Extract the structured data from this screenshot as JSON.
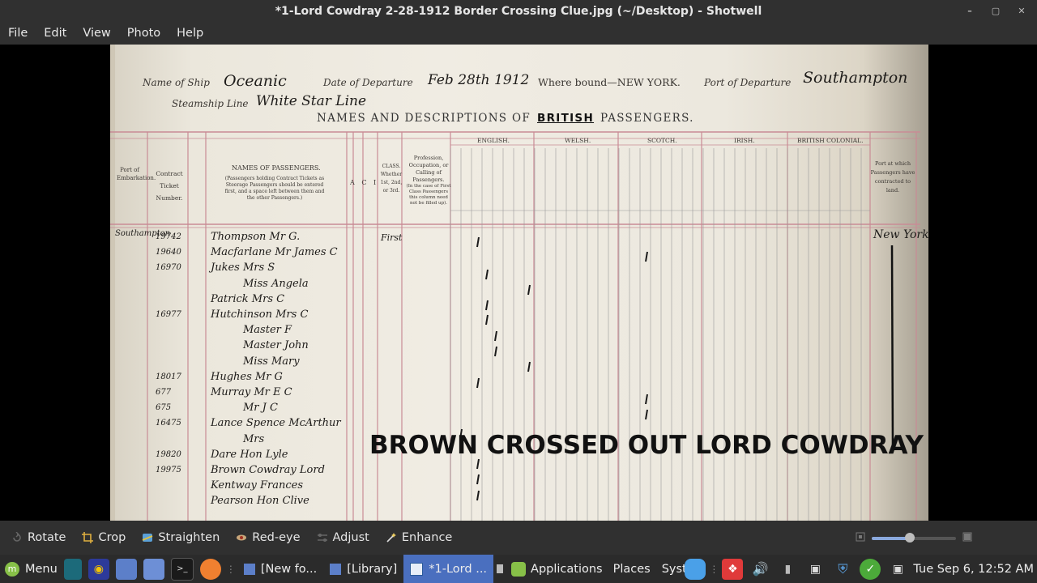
{
  "window": {
    "title": "*1-Lord Cowdray 2-28-1912 Border Crossing Clue.jpg (~/Desktop) - Shotwell",
    "minimize": "–",
    "restore": "▢",
    "close": "✕"
  },
  "menu": [
    "File",
    "Edit",
    "View",
    "Photo",
    "Help"
  ],
  "photo": {
    "header": {
      "name_of_ship_label": "Name of Ship",
      "name_of_ship": "Oceanic",
      "date_label": "Date of Departure",
      "date": "Feb 28th 1912",
      "where_bound_label": "Where bound—NEW YORK.",
      "port_label": "Port of Departure",
      "port": "Southampton",
      "steamship_label": "Steamship Line",
      "steamship": "White Star Line",
      "title_1": "NAMES AND DESCRIPTIONS OF",
      "title_british": "BRITISH",
      "title_2": "PASSENGERS."
    },
    "columns": {
      "port_embarkation": "Port of Embarkation.",
      "contract": "Contract Ticket Number.",
      "names": "NAMES OF PASSENGERS.",
      "names_note": "(Passengers holding Contract Tickets as Steerage Passengers should be entered first, and a space left between them and the other Passengers.)",
      "class_marks": "A C I",
      "class": "CLASS. Whether 1st, 2nd, or 3rd.",
      "profession": "Profession, Occupation, or Calling of Passengers.",
      "profession_note": "(In the case of First Class Passengers this column need not be filled up).",
      "groups": [
        "ENGLISH.",
        "WELSH.",
        "SCOTCH.",
        "IRISH.",
        "BRITISH COLONIAL."
      ],
      "port_landing": "Port at which Passengers have contracted to land."
    },
    "rows": [
      {
        "port": "Southampton",
        "ticket": "19742",
        "name": "Thompson Mr G.",
        "class": "First"
      },
      {
        "port": "",
        "ticket": "19640",
        "name": "Macfarlane Mr James C",
        "class": ""
      },
      {
        "port": "",
        "ticket": "16970",
        "name": "Jukes Mrs S",
        "class": ""
      },
      {
        "port": "",
        "ticket": "",
        "name": "Miss Angela",
        "class": ""
      },
      {
        "port": "",
        "ticket": "",
        "name": "Patrick Mrs C",
        "class": ""
      },
      {
        "port": "",
        "ticket": "16977",
        "name": "Hutchinson Mrs C",
        "class": ""
      },
      {
        "port": "",
        "ticket": "",
        "name": "Master F",
        "class": ""
      },
      {
        "port": "",
        "ticket": "",
        "name": "Master John",
        "class": ""
      },
      {
        "port": "",
        "ticket": "",
        "name": "Miss Mary",
        "class": ""
      },
      {
        "port": "",
        "ticket": "18017",
        "name": "Hughes Mr G",
        "class": ""
      },
      {
        "port": "",
        "ticket": "677",
        "name": "Murray Mr E C",
        "class": ""
      },
      {
        "port": "",
        "ticket": "675",
        "name": "Mr J C",
        "class": ""
      },
      {
        "port": "",
        "ticket": "16475",
        "name": "Lance Spence McArthur",
        "class": ""
      },
      {
        "port": "",
        "ticket": "",
        "name": "Mrs",
        "class": ""
      },
      {
        "port": "",
        "ticket": "19820",
        "name": "Dare Hon Lyle",
        "class": ""
      },
      {
        "port": "",
        "ticket": "19975",
        "name": "Brown Cowdray Lord",
        "class": ""
      },
      {
        "port": "",
        "ticket": "",
        "name": "Kentway Frances",
        "class": ""
      },
      {
        "port": "",
        "ticket": "",
        "name": "Pearson Hon Clive",
        "class": ""
      }
    ],
    "landing_port": "New York",
    "caption": "BROWN CROSSED OUT LORD COWDRAY"
  },
  "toolbar": {
    "rotate": "Rotate",
    "crop": "Crop",
    "straighten": "Straighten",
    "redeye": "Red-eye",
    "adjust": "Adjust",
    "enhance": "Enhance",
    "zoom_level": 0.45
  },
  "panel": {
    "menu": "Menu",
    "task_new_folder": "[New fo...",
    "task_library": "[Library]",
    "task_shotwell": "*1-Lord ...",
    "applications": "Applications",
    "places": "Places",
    "system": "System",
    "clock": "Tue Sep  6, 12:52 AM"
  },
  "colors": {
    "chrome": "#303030",
    "panel": "#2b2b2b",
    "active_task": "#4a6fbf",
    "paper": "#ece8de",
    "ruling_red": "#c98b95",
    "mint_green": "#87c048"
  }
}
